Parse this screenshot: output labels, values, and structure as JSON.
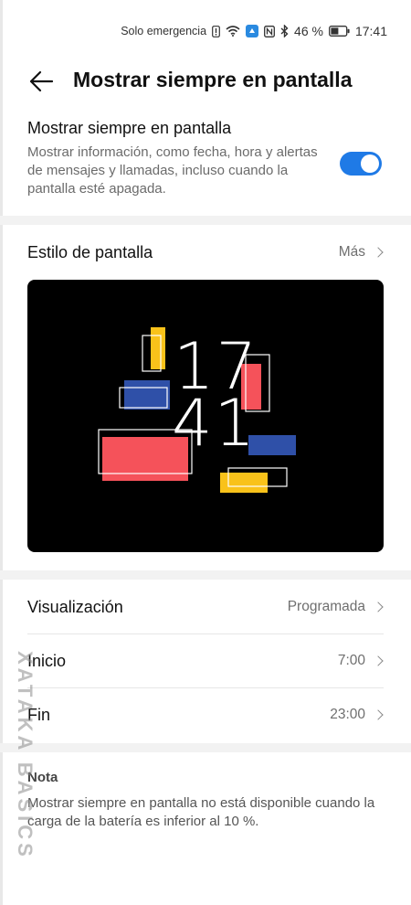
{
  "status_bar": {
    "carrier_text": "Solo emergencia",
    "battery_percent": "46 %",
    "time": "17:41",
    "icons": [
      "alert-icon",
      "wifi-icon",
      "app-notification-icon",
      "nfc-icon",
      "bluetooth-icon",
      "battery-icon"
    ]
  },
  "app_bar": {
    "title": "Mostrar siempre en pantalla"
  },
  "always_on": {
    "title": "Mostrar siempre en pantalla",
    "description": "Mostrar información, como fecha, hora y alertas de mensajes y llamadas, incluso cuando la pantalla esté apagada.",
    "enabled": true,
    "accent_color": "#1f7ae6"
  },
  "display_style": {
    "label": "Estilo de pantalla",
    "more_label": "Más",
    "preview": {
      "hour": "17",
      "minute": "41",
      "colors": {
        "yellow": "#f9c21a",
        "red": "#f5525a",
        "blue": "#2f50a8",
        "background": "#000000"
      }
    }
  },
  "settings": {
    "visualization": {
      "label": "Visualización",
      "value": "Programada"
    },
    "start": {
      "label": "Inicio",
      "value": "7:00"
    },
    "end": {
      "label": "Fin",
      "value": "23:00"
    }
  },
  "note": {
    "title": "Nota",
    "text": "Mostrar siempre en pantalla no está disponible cuando la carga de la batería es inferior al 10 %."
  },
  "watermark": {
    "text": "XATAKA BASICS"
  }
}
